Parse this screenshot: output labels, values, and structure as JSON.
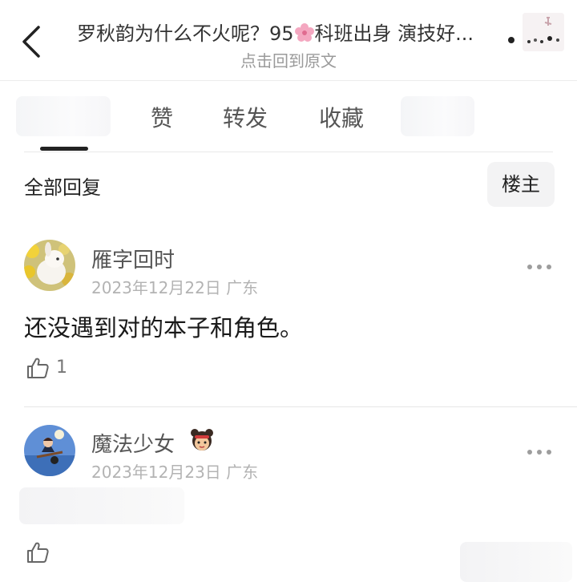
{
  "header": {
    "title_before": "罗秋韵为什么不火呢？95",
    "title_after": "科班出身 演技好...",
    "subtitle": "点击回到原文"
  },
  "tabs": {
    "items": [
      {
        "label": "赞"
      },
      {
        "label": "转发"
      },
      {
        "label": "收藏"
      }
    ]
  },
  "replies_bar": {
    "title": "全部回复",
    "owner_label": "楼主"
  },
  "comments": [
    {
      "username": "雁字回时",
      "date": "2023年12月22日",
      "location": "广东",
      "text": "还没遇到对的本子和角色。",
      "likes": "1"
    },
    {
      "username": "魔法少女",
      "date": "2023年12月23日",
      "location": "广东",
      "text": "",
      "likes": ""
    }
  ],
  "icons": {
    "back": "chevron-left-icon",
    "more": "more-dots-icon",
    "like": "thumbs-up-icon",
    "title_emoji": "cherry-blossom-icon",
    "user_emoji": "girl-face-emoji"
  },
  "colors": {
    "text_primary": "#222222",
    "text_secondary": "#9a9a9a",
    "indicator": "#222222",
    "emoji_pink": "#f4a7c0"
  }
}
